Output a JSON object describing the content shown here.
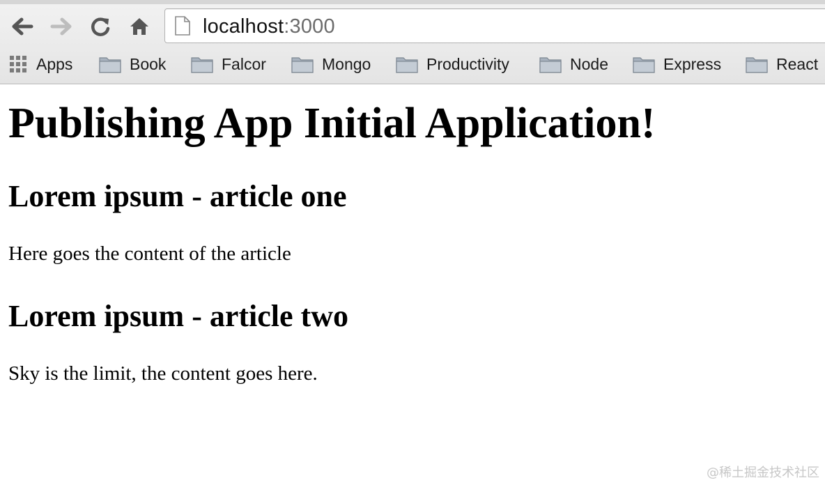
{
  "browser": {
    "url_host": "localhost",
    "url_port": ":3000",
    "nav_icons": [
      "back-arrow-icon",
      "forward-arrow-icon",
      "reload-icon",
      "home-icon"
    ],
    "bookmarks": [
      {
        "label": "Apps",
        "icon": "apps-grid-icon"
      },
      {
        "label": "Book",
        "icon": "folder-icon"
      },
      {
        "label": "Falcor",
        "icon": "folder-icon"
      },
      {
        "label": "Mongo",
        "icon": "folder-icon"
      },
      {
        "label": "Productivity",
        "icon": "folder-icon"
      },
      {
        "label": "Node",
        "icon": "folder-icon"
      },
      {
        "label": "Express",
        "icon": "folder-icon"
      },
      {
        "label": "React",
        "icon": "folder-icon"
      }
    ]
  },
  "page": {
    "title": "Publishing App Initial Application!",
    "articles": [
      {
        "title": "Lorem ipsum - article one",
        "content": "Here goes the content of the article"
      },
      {
        "title": "Lorem ipsum - article two",
        "content": "Sky is the limit, the content goes here."
      }
    ]
  },
  "watermark": "@稀土掘金技术社区"
}
